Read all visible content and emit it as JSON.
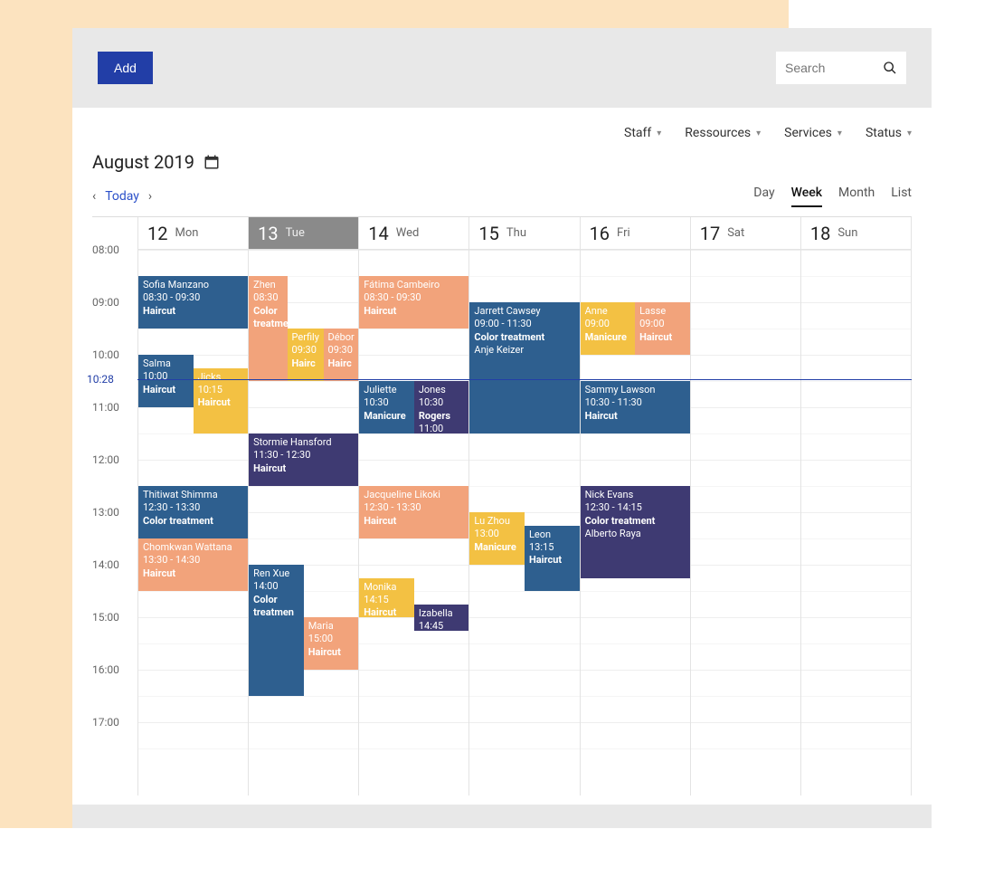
{
  "toolbar": {
    "add_label": "Add",
    "search_placeholder": "Search"
  },
  "filters": [
    "Staff",
    "Ressources",
    "Services",
    "Status"
  ],
  "title": "August 2019",
  "nav": {
    "today": "Today"
  },
  "views": [
    "Day",
    "Week",
    "Month",
    "List"
  ],
  "active_view": "Week",
  "now_label": "10:28",
  "now_hour": 10.47,
  "hours_start": 8,
  "hours_end": 18,
  "hour_height": 58,
  "time_labels": [
    "08:00",
    "09:00",
    "10:00",
    "11:00",
    "12:00",
    "13:00",
    "14:00",
    "15:00",
    "16:00",
    "17:00"
  ],
  "days": [
    {
      "num": "12",
      "name": "Mon",
      "selected": false
    },
    {
      "num": "13",
      "name": "Tue",
      "selected": true
    },
    {
      "num": "14",
      "name": "Wed",
      "selected": false
    },
    {
      "num": "15",
      "name": "Thu",
      "selected": false
    },
    {
      "num": "16",
      "name": "Fri",
      "selected": false
    },
    {
      "num": "17",
      "name": "Sat",
      "selected": false
    },
    {
      "num": "18",
      "name": "Sun",
      "selected": false
    }
  ],
  "colors": {
    "blue": "#2e5f8f",
    "orange": "#f2a37b",
    "yellow": "#f3c143",
    "purple": "#3e3a72"
  },
  "events": [
    {
      "day": 0,
      "start": 8.5,
      "end": 9.5,
      "left": 0,
      "width": 1,
      "color": "blue",
      "name": "Sofia Manzano",
      "time": "08:30 - 09:30",
      "service": "Haircut"
    },
    {
      "day": 0,
      "start": 10.0,
      "end": 11.0,
      "left": 0,
      "width": 0.5,
      "color": "blue",
      "name": "Salma",
      "time": "10:00",
      "service": "Haircut"
    },
    {
      "day": 0,
      "start": 10.25,
      "end": 11.5,
      "left": 0.5,
      "width": 0.5,
      "color": "yellow",
      "name": "Jicks",
      "time": "10:15",
      "service": "Haircut"
    },
    {
      "day": 0,
      "start": 12.5,
      "end": 13.5,
      "left": 0,
      "width": 1,
      "color": "blue",
      "name": "Thitiwat Shimma",
      "time": "12:30 - 13:30",
      "service": "Color treatment"
    },
    {
      "day": 0,
      "start": 13.5,
      "end": 14.5,
      "left": 0,
      "width": 1,
      "color": "orange",
      "name": "Chomkwan Wattana",
      "time": "13:30 - 14:30",
      "service": "Haircut"
    },
    {
      "day": 1,
      "start": 8.5,
      "end": 10.5,
      "left": 0,
      "width": 0.35,
      "color": "orange",
      "name": "Zhen",
      "time": "08:30",
      "service": "Color treatment"
    },
    {
      "day": 1,
      "start": 9.5,
      "end": 10.5,
      "left": 0.35,
      "width": 0.33,
      "color": "yellow",
      "name": "Perfily",
      "time": "09:30",
      "service": "Hairc"
    },
    {
      "day": 1,
      "start": 9.5,
      "end": 10.5,
      "left": 0.68,
      "width": 0.32,
      "color": "orange",
      "name": "Débor",
      "time": "09:30",
      "service": "Hairc"
    },
    {
      "day": 1,
      "start": 11.5,
      "end": 12.5,
      "left": 0,
      "width": 1,
      "color": "purple",
      "name": "Stormie Hansford",
      "time": "11:30 - 12:30",
      "service": "Haircut"
    },
    {
      "day": 1,
      "start": 14.0,
      "end": 16.5,
      "left": 0,
      "width": 0.5,
      "color": "blue",
      "name": "Ren Xue",
      "time": "14:00",
      "service": "Color treatmen"
    },
    {
      "day": 1,
      "start": 15.0,
      "end": 16.0,
      "left": 0.5,
      "width": 0.5,
      "color": "orange",
      "name": "Maria",
      "time": "15:00",
      "service": "Haircut"
    },
    {
      "day": 2,
      "start": 8.5,
      "end": 9.5,
      "left": 0,
      "width": 1,
      "color": "orange",
      "name": "Fátima Cambeiro",
      "time": "08:30 - 09:30",
      "service": "Haircut"
    },
    {
      "day": 2,
      "start": 10.5,
      "end": 11.5,
      "left": 0,
      "width": 0.5,
      "color": "blue",
      "name": "Juliette",
      "time": "10:30",
      "service": "Manicure"
    },
    {
      "day": 2,
      "start": 10.5,
      "end": 11.5,
      "left": 0.5,
      "width": 0.5,
      "color": "purple",
      "name": "Jones",
      "time": "10:30",
      "service": "Rogers",
      "extra": "11:00"
    },
    {
      "day": 2,
      "start": 12.5,
      "end": 13.5,
      "left": 0,
      "width": 1,
      "color": "orange",
      "name": "Jacqueline Likoki",
      "time": "12:30 - 13:30",
      "service": "Haircut"
    },
    {
      "day": 2,
      "start": 14.25,
      "end": 15.0,
      "left": 0,
      "width": 0.5,
      "color": "yellow",
      "name": "Monika",
      "time": "14:15",
      "service": "Haircut"
    },
    {
      "day": 2,
      "start": 14.75,
      "end": 15.25,
      "left": 0.5,
      "width": 0.5,
      "color": "purple",
      "name": "Izabella",
      "time": "14:45"
    },
    {
      "day": 3,
      "start": 9.0,
      "end": 11.5,
      "left": 0,
      "width": 1,
      "color": "blue",
      "name": "Jarrett Cawsey",
      "time": "09:00 - 11:30",
      "service": "Color treatment",
      "extra": "Anje Keizer"
    },
    {
      "day": 3,
      "start": 13.0,
      "end": 14.0,
      "left": 0,
      "width": 0.5,
      "color": "yellow",
      "name": "Lu Zhou",
      "time": "13:00",
      "service": "Manicure"
    },
    {
      "day": 3,
      "start": 13.25,
      "end": 14.5,
      "left": 0.5,
      "width": 0.5,
      "color": "blue",
      "name": "Leon",
      "time": "13:15",
      "service": "Haircut"
    },
    {
      "day": 4,
      "start": 9.0,
      "end": 10.0,
      "left": 0,
      "width": 0.5,
      "color": "yellow",
      "name": "Anne",
      "time": "09:00",
      "service": "Manicure"
    },
    {
      "day": 4,
      "start": 9.0,
      "end": 10.0,
      "left": 0.5,
      "width": 0.5,
      "color": "orange",
      "name": "Lasse",
      "time": "09:00",
      "service": "Haircut"
    },
    {
      "day": 4,
      "start": 10.5,
      "end": 11.5,
      "left": 0,
      "width": 1,
      "color": "blue",
      "name": "Sammy Lawson",
      "time": "10:30 - 11:30",
      "service": "Haircut"
    },
    {
      "day": 4,
      "start": 12.5,
      "end": 14.25,
      "left": 0,
      "width": 1,
      "color": "purple",
      "name": "Nick Evans",
      "time": "12:30 - 14:15",
      "service": "Color treatment",
      "extra": "Alberto Raya"
    }
  ]
}
